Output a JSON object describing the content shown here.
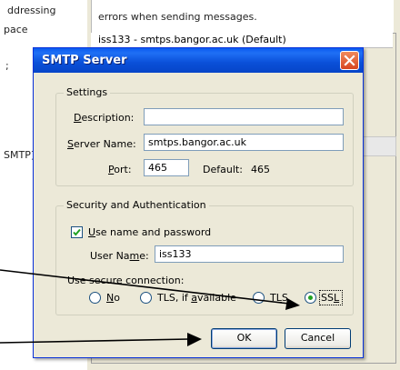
{
  "background": {
    "left_texts": [
      "ddressing",
      "pace",
      ";",
      "SMTP]"
    ],
    "top_message": "errors when sending messages.",
    "list_partial": "iss133 - smtps.bangor.ac.uk (Default)"
  },
  "dialog": {
    "title": "SMTP Server",
    "settings": {
      "legend": "Settings",
      "description_label": "Description:",
      "description_value": "",
      "server_name_label": "Server Name:",
      "server_name_value": "smtps.bangor.ac.uk",
      "port_label": "Port:",
      "port_value": "465",
      "default_label": "Default:",
      "default_value": "465"
    },
    "security": {
      "legend": "Security and Authentication",
      "use_name_password_label": "Use name and password",
      "use_name_password_checked": true,
      "user_name_label": "User Name:",
      "user_name_value": "iss133",
      "secure_connection_label": "Use secure connection:",
      "options": [
        "No",
        "TLS, if available",
        "TLS",
        "SSL"
      ],
      "selected": "SSL"
    },
    "buttons": {
      "ok": "OK",
      "cancel": "Cancel"
    }
  },
  "colors": {
    "title_bar": "#0a5bf0",
    "dialog_bg": "#ece9d8",
    "close_button": "#d8451f",
    "radio_dot": "#21a121"
  }
}
